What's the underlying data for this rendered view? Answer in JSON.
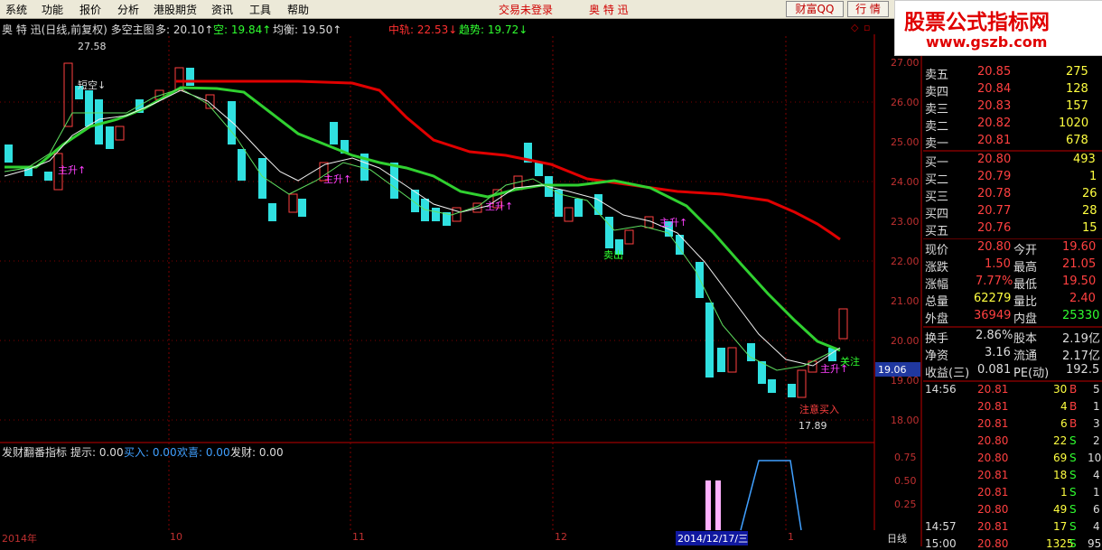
{
  "menu": [
    "系统",
    "功能",
    "报价",
    "分析",
    "港股期货",
    "资讯",
    "工具",
    "帮助"
  ],
  "menu_center": [
    "交易未登录",
    "奥 特 迅"
  ],
  "top_buttons": [
    "财富QQ",
    "行 情"
  ],
  "watermark": {
    "title": "股票公式指标网",
    "url": "www.gszb.com"
  },
  "main_info": {
    "name": "奥 特 迅(日线,前复权) 多空主图",
    "duo": "多: 20.10↑",
    "kong": "空: 19.84↑",
    "junheng": "均衡: 19.50↑",
    "zhonggui": "中轨: 22.53↓",
    "qushi": "趋势: 19.72↓"
  },
  "chart_labels": {
    "high": "27.58",
    "low": "17.89",
    "duankong": "短空↓",
    "zhusheng": "主升↑",
    "maichu": "卖出",
    "zhuyimairu": "注意买入",
    "guanzhu": "关注",
    "current_price": "19.06"
  },
  "price_axis": [
    "27.00",
    "26.00",
    "25.00",
    "24.00",
    "23.00",
    "22.00",
    "21.00",
    "20.00",
    "19.00",
    "18.00"
  ],
  "sub_info": {
    "name": "发财翻番指标",
    "tishi": "提示: 0.00",
    "mairu": "买入: 0.00",
    "huanxi": "欢喜: 0.00",
    "facai": "发财: 0.00"
  },
  "sub_axis": [
    "0.75",
    "0.50",
    "0.25"
  ],
  "date_axis": [
    "2014年",
    "10",
    "11",
    "12",
    "2014/12/17/三",
    "1"
  ],
  "period": "日线",
  "order_book": {
    "sell": [
      {
        "label": "卖五",
        "price": "20.85",
        "vol": "275"
      },
      {
        "label": "卖四",
        "price": "20.84",
        "vol": "128"
      },
      {
        "label": "卖三",
        "price": "20.83",
        "vol": "157"
      },
      {
        "label": "卖二",
        "price": "20.82",
        "vol": "1020"
      },
      {
        "label": "卖一",
        "price": "20.81",
        "vol": "678"
      }
    ],
    "buy": [
      {
        "label": "买一",
        "price": "20.80",
        "vol": "493"
      },
      {
        "label": "买二",
        "price": "20.79",
        "vol": "1"
      },
      {
        "label": "买三",
        "price": "20.78",
        "vol": "26"
      },
      {
        "label": "买四",
        "price": "20.77",
        "vol": "28"
      },
      {
        "label": "买五",
        "price": "20.76",
        "vol": "15"
      }
    ]
  },
  "stats": [
    {
      "l1": "现价",
      "v1": "20.80",
      "l2": "今开",
      "v2": "19.60"
    },
    {
      "l1": "涨跌",
      "v1": "1.50",
      "l2": "最高",
      "v2": "21.05"
    },
    {
      "l1": "涨幅",
      "v1": "7.77%",
      "l2": "最低",
      "v2": "19.50"
    },
    {
      "l1": "总量",
      "v1": "62279",
      "l2": "量比",
      "v2": "2.40"
    },
    {
      "l1": "外盘",
      "v1": "36949",
      "l2": "内盘",
      "v2": "25330"
    }
  ],
  "fund": [
    {
      "l1": "换手",
      "v1": "2.86%",
      "l2": "股本",
      "v2": "2.19亿"
    },
    {
      "l1": "净资",
      "v1": "3.16",
      "l2": "流通",
      "v2": "2.17亿"
    },
    {
      "l1": "收益(三)",
      "v1": "0.081",
      "l2": "PE(动)",
      "v2": "192.5"
    }
  ],
  "ticks": [
    {
      "time": "14:56",
      "price": "20.81",
      "vol": "30",
      "bs": "B",
      "n": "5"
    },
    {
      "time": "",
      "price": "20.81",
      "vol": "4",
      "bs": "B",
      "n": "1"
    },
    {
      "time": "",
      "price": "20.81",
      "vol": "6",
      "bs": "B",
      "n": "3"
    },
    {
      "time": "",
      "price": "20.80",
      "vol": "22",
      "bs": "S",
      "n": "2"
    },
    {
      "time": "",
      "price": "20.80",
      "vol": "69",
      "bs": "S",
      "n": "10"
    },
    {
      "time": "",
      "price": "20.81",
      "vol": "18",
      "bs": "S",
      "n": "4"
    },
    {
      "time": "",
      "price": "20.81",
      "vol": "1",
      "bs": "S",
      "n": "1"
    },
    {
      "time": "",
      "price": "20.80",
      "vol": "49",
      "bs": "S",
      "n": "6"
    },
    {
      "time": "14:57",
      "price": "20.81",
      "vol": "17",
      "bs": "S",
      "n": "4"
    },
    {
      "time": "15:00",
      "price": "20.80",
      "vol": "1325",
      "bs": "S",
      "n": "95"
    }
  ],
  "colors": {
    "up": "#ff4040",
    "down": "#30e0e0",
    "green_line": "#30d030",
    "red_line": "#e00000",
    "grid": "#800000"
  }
}
